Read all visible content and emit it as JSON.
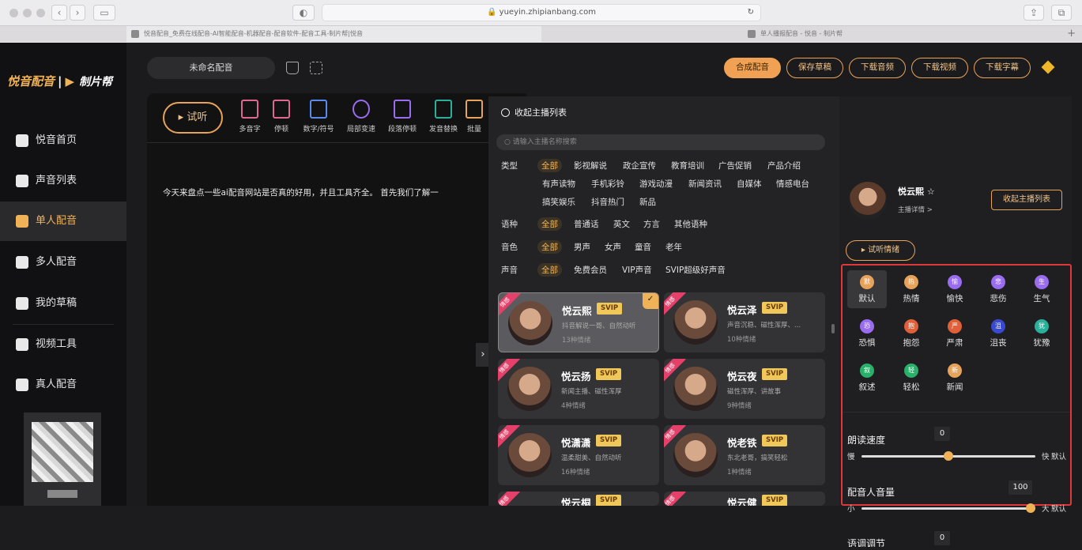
{
  "browser": {
    "url": "yueyin.zhipianbang.com",
    "tabs": [
      {
        "title": "悦音配音_免费在线配音-AI智能配音-机器配音-配音软件-配音工具-制片帮|悦音",
        "active": true
      },
      {
        "title": "单人播报配音 - 悦音 - 制片帮",
        "active": false
      }
    ]
  },
  "sidebar": {
    "logo": "悦音配音",
    "logo_sub": "制片帮",
    "items": [
      {
        "label": "悦音首页",
        "active": false
      },
      {
        "label": "声音列表",
        "active": false
      },
      {
        "label": "单人配音",
        "active": true
      },
      {
        "label": "多人配音",
        "active": false
      },
      {
        "label": "我的草稿",
        "active": false
      },
      {
        "label": "视频工具",
        "active": false
      },
      {
        "label": "真人配音",
        "active": false
      }
    ]
  },
  "topbar": {
    "project_name": "未命名配音",
    "buttons": [
      "合成配音",
      "保存草稿",
      "下载音频",
      "下载视频",
      "下载字幕"
    ]
  },
  "editor": {
    "listen_label": "试听",
    "tools": [
      "多音字",
      "停顿",
      "数字/符号",
      "局部变速",
      "段落停顿",
      "发音替换",
      "批量"
    ],
    "text": "今天来盘点一些ai配音网站是否真的好用，并且工具齐全。 首先我们了解一"
  },
  "panel": {
    "title": "收起主播列表",
    "search_placeholder": "请输入主播名称搜索",
    "filters": [
      {
        "label": "类型",
        "options": [
          "全部",
          "影视解说",
          "政企宣传",
          "教育培训",
          "广告促销",
          "产品介绍",
          "有声读物",
          "手机彩铃",
          "游戏动漫",
          "新闻资讯",
          "自媒体",
          "情感电台",
          "搞笑娱乐",
          "抖音热门",
          "新品"
        ]
      },
      {
        "label": "语种",
        "options": [
          "全部",
          "普通话",
          "英文",
          "方言",
          "其他语种"
        ]
      },
      {
        "label": "音色",
        "options": [
          "全部",
          "男声",
          "女声",
          "童音",
          "老年"
        ]
      },
      {
        "label": "声音",
        "options": [
          "全部",
          "免费会员",
          "VIP声音",
          "SVIP超级好声音"
        ]
      }
    ],
    "ribbon": "情感",
    "voices": [
      {
        "name": "悦云熙",
        "badge": "SVIP",
        "desc": "抖音解说一哥、自然动听",
        "emotions": "13种情绪",
        "selected": true
      },
      {
        "name": "悦云泽",
        "badge": "SVIP",
        "desc": "声音沉稳、磁性浑厚、...",
        "emotions": "10种情绪",
        "selected": false
      },
      {
        "name": "悦云扬",
        "badge": "SVIP",
        "desc": "新闻主播、磁性浑厚",
        "emotions": "4种情绪",
        "selected": false
      },
      {
        "name": "悦云夜",
        "badge": "SVIP",
        "desc": "磁性浑厚、讲故事",
        "emotions": "9种情绪",
        "selected": false
      },
      {
        "name": "悦潇潇",
        "badge": "SVIP",
        "desc": "温柔甜美、自然动听",
        "emotions": "16种情绪",
        "selected": false
      },
      {
        "name": "悦老铁",
        "badge": "SVIP",
        "desc": "东北老哥，搞笑轻松",
        "emotions": "1种情绪",
        "selected": false
      },
      {
        "name": "悦云桐",
        "badge": "SVIP",
        "desc": "",
        "emotions": "",
        "selected": false
      },
      {
        "name": "悦云健",
        "badge": "SVIP",
        "desc": "",
        "emotions": "",
        "selected": false
      }
    ]
  },
  "selected_voice": {
    "name": "悦云熙",
    "sub": "主播详情 >",
    "collapse_label": "收起主播列表",
    "emotion_button": "试听情绪",
    "emotions": [
      {
        "label": "默认",
        "glyph": "默",
        "color": "#e8a35a",
        "selected": true
      },
      {
        "label": "热情",
        "glyph": "热",
        "color": "#e8a35a",
        "selected": false
      },
      {
        "label": "愉快",
        "glyph": "愉",
        "color": "#9a6cf0",
        "selected": false
      },
      {
        "label": "悲伤",
        "glyph": "悲",
        "color": "#9a6cf0",
        "selected": false
      },
      {
        "label": "生气",
        "glyph": "生",
        "color": "#9a6cf0",
        "selected": false
      },
      {
        "label": "恐惧",
        "glyph": "恐",
        "color": "#9a6cf0",
        "selected": false
      },
      {
        "label": "抱怨",
        "glyph": "抱",
        "color": "#e0603a",
        "selected": false
      },
      {
        "label": "严肃",
        "glyph": "严",
        "color": "#e0603a",
        "selected": false
      },
      {
        "label": "沮丧",
        "glyph": "沮",
        "color": "#3a4ad0",
        "selected": false
      },
      {
        "label": "犹豫",
        "glyph": "犹",
        "color": "#2ab09a",
        "selected": false
      },
      {
        "label": "叙述",
        "glyph": "叙",
        "color": "#2ab06a",
        "selected": false
      },
      {
        "label": "轻松",
        "glyph": "轻",
        "color": "#2ab06a",
        "selected": false
      },
      {
        "label": "新闻",
        "glyph": "新",
        "color": "#e8a35a",
        "selected": false
      }
    ],
    "sliders": [
      {
        "label": "朗读速度",
        "value": "0",
        "min_label": "慢",
        "max_label": "快",
        "default_label": "默认",
        "fraction": 0.5
      },
      {
        "label": "配音人音量",
        "value": "100",
        "min_label": "小",
        "max_label": "大",
        "default_label": "默认",
        "fraction": 1.0
      },
      {
        "label": "语调调节",
        "value": "0"
      }
    ]
  }
}
